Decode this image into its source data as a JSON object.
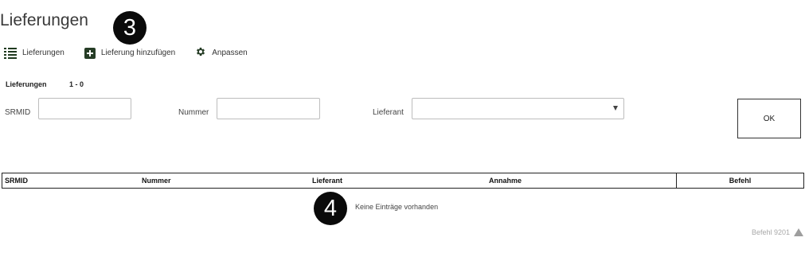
{
  "page": {
    "title": "Lieferungen"
  },
  "callouts": {
    "first": "3",
    "second": "4"
  },
  "toolbar": {
    "list_label": "Lieferungen",
    "add_label": "Lieferung hinzufügen",
    "customize_label": "Anpassen",
    "list_icon": "list-icon",
    "add_icon": "plus-square-icon",
    "customize_icon": "gear-icon",
    "icon_color": "#263d26"
  },
  "filter": {
    "section_label": "Lieferungen",
    "range": "1 - 0",
    "srmid_label": "SRMID",
    "srmid_value": "",
    "nummer_label": "Nummer",
    "nummer_value": "",
    "lieferant_label": "Lieferant",
    "lieferant_value": "",
    "ok_label": "OK"
  },
  "table": {
    "columns": [
      "SRMID",
      "Nummer",
      "Lieferant",
      "Annahme",
      "Befehl"
    ],
    "rows": [],
    "empty_message": "Keine Einträge vorhanden"
  },
  "footer": {
    "command_code": "Befehl 9201",
    "scroll_top_icon": "triangle-up-icon"
  }
}
